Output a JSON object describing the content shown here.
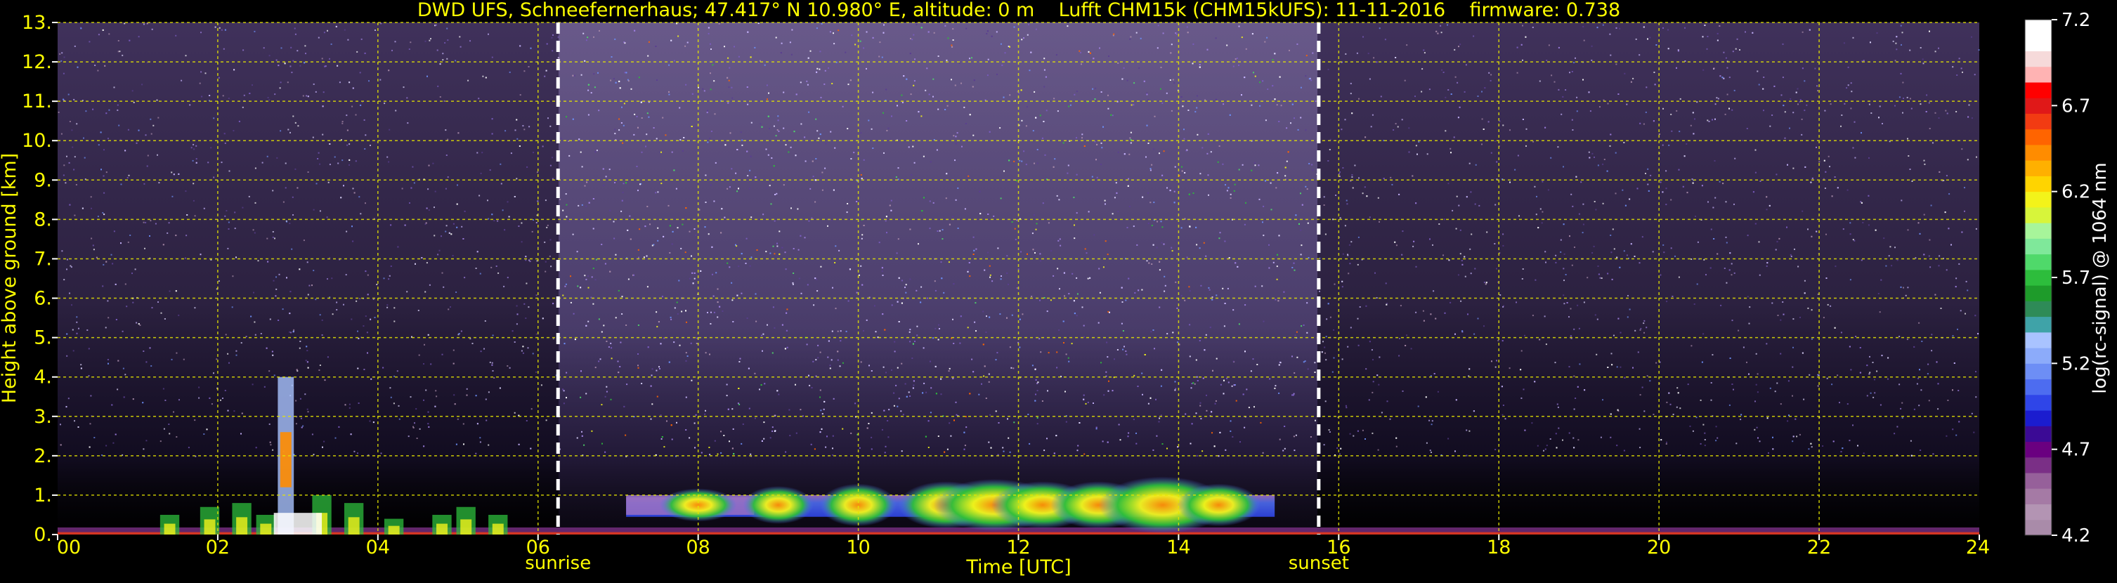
{
  "chart_data": {
    "type": "heatmap",
    "title": "DWD UFS, Schneefernerhaus; 47.417° N 10.980° E, altitude: 0 m    Lufft CHM15k (CHM15kUFS): 11-11-2016    firmware: 0.738",
    "xlabel": "Time [UTC]",
    "ylabel": "Height above ground [km]",
    "x_ticks": [
      "00",
      "02",
      "04",
      "06",
      "08",
      "10",
      "12",
      "14",
      "16",
      "18",
      "20",
      "22",
      "24"
    ],
    "y_ticks": [
      "0.",
      "1.",
      "2.",
      "3.",
      "4.",
      "5.",
      "6.",
      "7.",
      "8.",
      "9.",
      "10.",
      "11.",
      "12.",
      "13."
    ],
    "xlim": [
      0,
      24
    ],
    "ylim": [
      0,
      13
    ],
    "grid": true,
    "markers": [
      {
        "label": "sunrise",
        "x": 6.25
      },
      {
        "label": "sunset",
        "x": 15.75
      }
    ],
    "colorbar": {
      "label": "log(rc-signal) @ 1064 nm",
      "ticks": [
        "4.2",
        "4.7",
        "5.2",
        "5.7",
        "6.2",
        "6.7",
        "7.2"
      ],
      "range": [
        4.2,
        7.2
      ],
      "colors": [
        "#a98ba9",
        "#b394b3",
        "#a57aa5",
        "#96609a",
        "#7a2f86",
        "#6a0080",
        "#3b0a95",
        "#1b1ccf",
        "#2f45e8",
        "#4d6cf0",
        "#6d8ef5",
        "#8cabfa",
        "#a9c3ff",
        "#3fa3a8",
        "#2e8b57",
        "#1e9b2a",
        "#2dbd3c",
        "#4fd96a",
        "#7fe89a",
        "#a7f59a",
        "#d7f53a",
        "#f3f31a",
        "#ffd400",
        "#ffb000",
        "#ff8c00",
        "#ff6400",
        "#f23b12",
        "#e01818",
        "#ff0000",
        "#ffb3b3",
        "#f6dada",
        "#ffffff",
        "#ffffff"
      ]
    },
    "annotations": [
      "sunrise",
      "sunset"
    ]
  },
  "colors": {
    "text": "#ffff00",
    "grid": "#e6e600",
    "axes_text": "#ffff00",
    "marker_line": "#ffffff"
  }
}
